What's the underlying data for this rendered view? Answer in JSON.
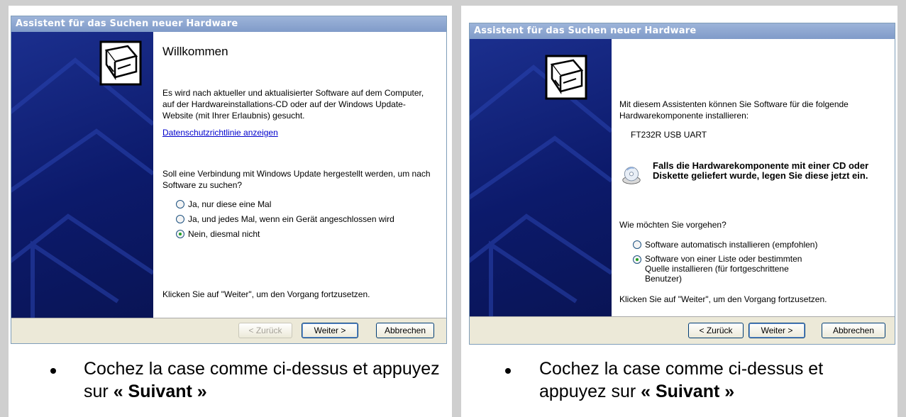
{
  "left": {
    "title": "Assistent für das Suchen neuer Hardware",
    "heading": "Willkommen",
    "intro": "Es wird nach aktueller und aktualisierter Software auf dem Computer, auf der Hardwareinstallations-CD oder auf der Windows Update-Website (mit Ihrer Erlaubnis) gesucht.",
    "privacy_link": "Datenschutzrichtlinie anzeigen",
    "question": "Soll eine Verbindung mit Windows Update hergestellt werden, um nach Software zu suchen?",
    "options": [
      {
        "label": "Ja, nur diese eine Mal",
        "checked": false
      },
      {
        "label": "Ja, und jedes Mal, wenn ein Gerät angeschlossen wird",
        "checked": false
      },
      {
        "label": "Nein, diesmal nicht",
        "checked": true
      }
    ],
    "footer": "Klicken Sie auf \"Weiter\", um den Vorgang fortzusetzen.",
    "buttons": {
      "back": "< Zurück",
      "next": "Weiter >",
      "cancel": "Abbrechen"
    }
  },
  "right": {
    "title": "Assistent für das Suchen neuer Hardware",
    "intro": "Mit diesem Assistenten können Sie Software für die folgende Hardwarekomponente installieren:",
    "device": "FT232R USB UART",
    "cd_note": "Falls die Hardwarekomponente mit einer CD oder Diskette geliefert wurde, legen Sie diese jetzt ein.",
    "question": "Wie möchten Sie vorgehen?",
    "options": [
      {
        "label": "Software automatisch installieren (empfohlen)",
        "checked": false
      },
      {
        "label": "Software von einer Liste oder bestimmten Quelle installieren (für fortgeschrittene Benutzer)",
        "checked": true
      }
    ],
    "footer": "Klicken Sie auf \"Weiter\", um den Vorgang fortzusetzen.",
    "buttons": {
      "back": "< Zurück",
      "next": "Weiter >",
      "cancel": "Abbrechen"
    }
  },
  "captions": {
    "left_text": "Cochez la case comme ci-dessus et appuyez sur ",
    "left_bold": "« Suivant »",
    "right_text": "Cochez la case comme ci-dessus et appuyez sur ",
    "right_bold": "« Suivant »"
  }
}
